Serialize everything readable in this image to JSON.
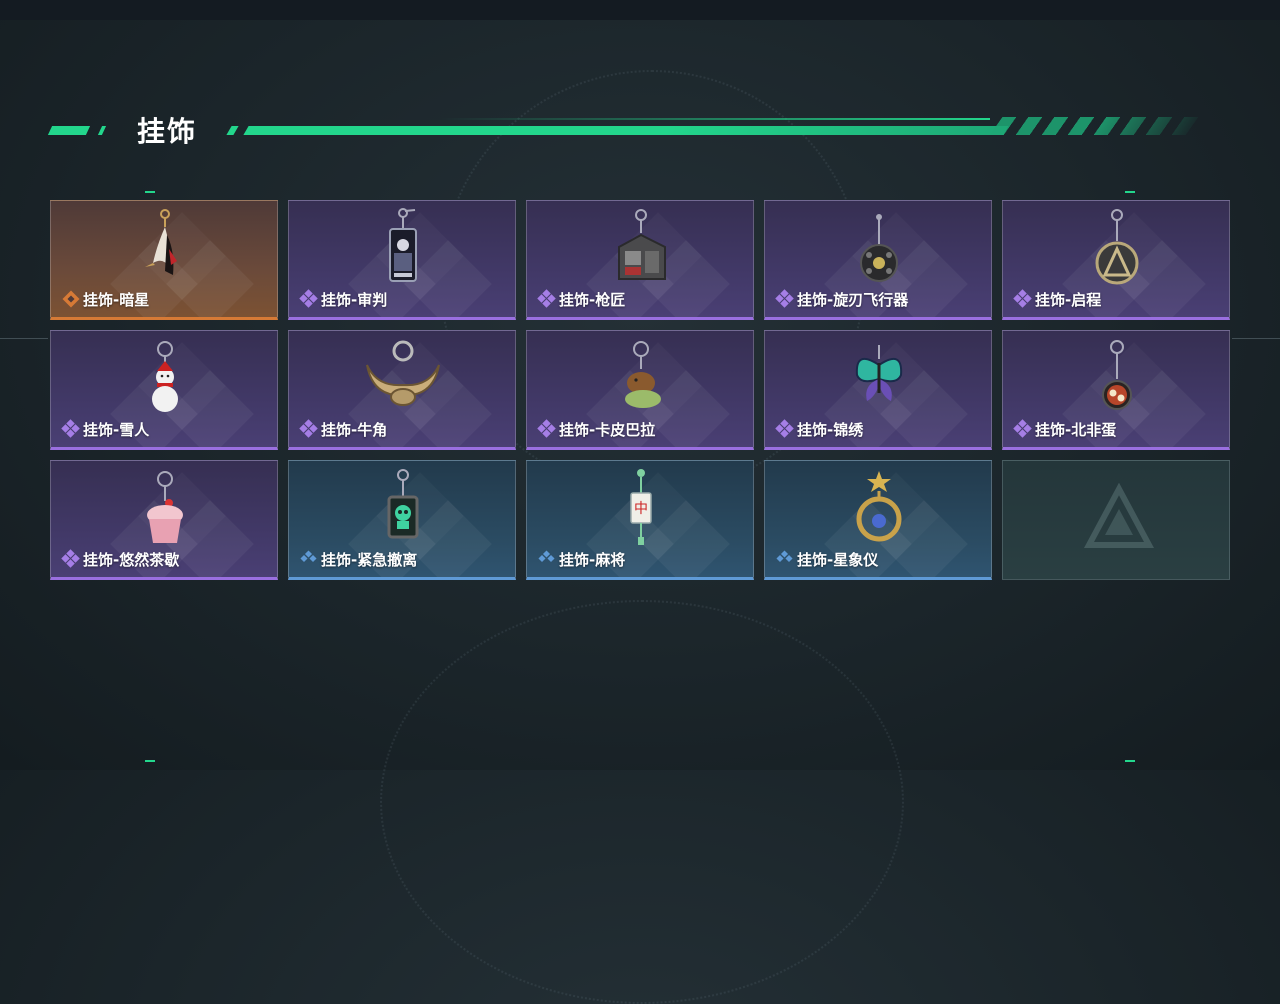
{
  "section": {
    "title": "挂饰"
  },
  "colors": {
    "accent": "#23d68c",
    "rarity_orange": "#d67a36",
    "rarity_purple": "#9a6fe0",
    "rarity_blue": "#5f9ad6"
  },
  "items": [
    {
      "label": "挂饰-暗星",
      "rarity": "orange",
      "icon": "crane-charm-icon"
    },
    {
      "label": "挂饰-审判",
      "rarity": "purple",
      "icon": "tarot-card-charm-icon"
    },
    {
      "label": "挂饰-枪匠",
      "rarity": "purple",
      "icon": "workbench-charm-icon"
    },
    {
      "label": "挂饰-旋刃飞行器",
      "rarity": "purple",
      "icon": "drone-charm-icon"
    },
    {
      "label": "挂饰-启程",
      "rarity": "purple",
      "icon": "medallion-charm-icon"
    },
    {
      "label": "挂饰-雪人",
      "rarity": "purple",
      "icon": "snowman-charm-icon"
    },
    {
      "label": "挂饰-牛角",
      "rarity": "purple",
      "icon": "bull-horns-charm-icon"
    },
    {
      "label": "挂饰-卡皮巴拉",
      "rarity": "purple",
      "icon": "capybara-charm-icon"
    },
    {
      "label": "挂饰-锦绣",
      "rarity": "purple",
      "icon": "butterfly-charm-icon"
    },
    {
      "label": "挂饰-北非蛋",
      "rarity": "purple",
      "icon": "shakshuka-charm-icon"
    },
    {
      "label": "挂饰-悠然茶歇",
      "rarity": "purple",
      "icon": "cupcake-charm-icon"
    },
    {
      "label": "挂饰-紧急撤离",
      "rarity": "blue",
      "icon": "skull-tag-charm-icon"
    },
    {
      "label": "挂饰-麻将",
      "rarity": "blue",
      "icon": "mahjong-tile-charm-icon"
    },
    {
      "label": "挂饰-星象仪",
      "rarity": "blue",
      "icon": "astrolabe-charm-icon"
    },
    {
      "label": "",
      "rarity": "empty",
      "icon": "game-logo-icon"
    }
  ]
}
